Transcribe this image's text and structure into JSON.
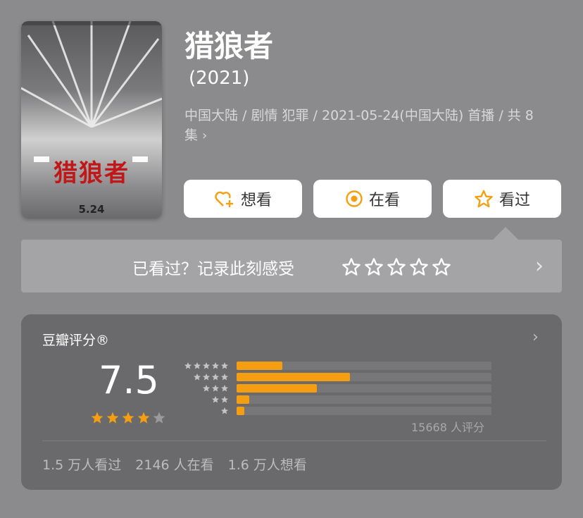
{
  "movie": {
    "poster": {
      "title_text": "猎狼者",
      "date_text": "5.24"
    },
    "title": "猎狼者",
    "year": "(2021)",
    "meta": "中国大陆 / 剧情 犯罪 / 2021-05-24(中国大陆) 首播 / 共 8 集",
    "meta_more": "›"
  },
  "actions": {
    "want": {
      "label": "想看",
      "icon": "heart-plus-icon"
    },
    "watching": {
      "label": "在看",
      "icon": "target-icon"
    },
    "watched": {
      "label": "看过",
      "icon": "star-outline-icon"
    }
  },
  "rate_prompt": {
    "text": "已看过？记录此刻感受",
    "stars": 5,
    "chevron": "›"
  },
  "rating": {
    "header": "豆瓣评分®",
    "chevron": "›",
    "score": "7.5",
    "stars_filled": 4,
    "stars_total": 5,
    "distribution": [
      {
        "stars": 5,
        "percent": 18
      },
      {
        "stars": 4,
        "percent": 44.5
      },
      {
        "stars": 3,
        "percent": 31.5
      },
      {
        "stars": 2,
        "percent": 5
      },
      {
        "stars": 1,
        "percent": 3
      }
    ],
    "votes": "15668 人评分"
  },
  "stats": {
    "watched": "1.5 万人看过",
    "watching": "2146 人在看",
    "want": "1.6 万人想看"
  },
  "colors": {
    "background": "#8b8b8d",
    "accent": "#f59e12",
    "card": "#6a6a6c"
  }
}
